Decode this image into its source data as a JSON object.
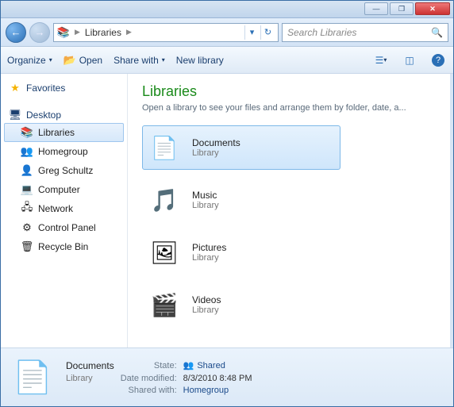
{
  "titlebar": {
    "minimize": "—",
    "maximize": "❐",
    "close": "✕"
  },
  "nav": {
    "back": "←",
    "forward": "→"
  },
  "address": {
    "root_icon": "libraries-icon",
    "crumb1": "Libraries",
    "dropdown": "▾",
    "refresh": "↻"
  },
  "search": {
    "placeholder": "Search Libraries",
    "icon": "🔍"
  },
  "toolbar": {
    "organize": "Organize",
    "open": "Open",
    "share": "Share with",
    "newlib": "New library",
    "drop": "▾"
  },
  "navpane": {
    "favorites": "Favorites",
    "desktop": "Desktop",
    "items": [
      {
        "label": "Libraries",
        "icon": "📚"
      },
      {
        "label": "Homegroup",
        "icon": "👥"
      },
      {
        "label": "Greg Schultz",
        "icon": "👤"
      },
      {
        "label": "Computer",
        "icon": "💻"
      },
      {
        "label": "Network",
        "icon": "🖧"
      },
      {
        "label": "Control Panel",
        "icon": "⚙"
      },
      {
        "label": "Recycle Bin",
        "icon": "🗑"
      }
    ]
  },
  "content": {
    "title": "Libraries",
    "subhead": "Open a library to see your files and arrange them by folder, date, a...",
    "items": [
      {
        "title": "Documents",
        "subtitle": "Library",
        "icon": "📄",
        "selected": true
      },
      {
        "title": "Music",
        "subtitle": "Library",
        "icon": "🎵",
        "selected": false
      },
      {
        "title": "Pictures",
        "subtitle": "Library",
        "icon": "🖼",
        "selected": false
      },
      {
        "title": "Videos",
        "subtitle": "Library",
        "icon": "🎬",
        "selected": false
      }
    ]
  },
  "details": {
    "name": "Documents",
    "type": "Library",
    "labels": {
      "state": "State:",
      "modified": "Date modified:",
      "shared_with": "Shared with:"
    },
    "state": "Shared",
    "modified": "8/3/2010 8:48 PM",
    "shared_with": "Homegroup"
  }
}
